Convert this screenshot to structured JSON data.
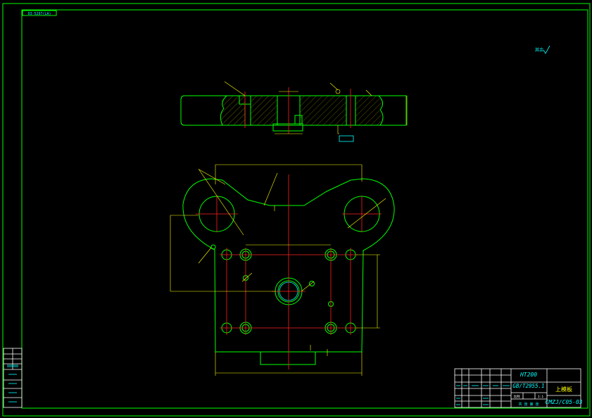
{
  "drawing": {
    "corner_code": "03-5297(LA)",
    "roughness_note": "其余",
    "title_block": {
      "material": "HT200",
      "standard": "GB/T2955.1",
      "part_name": "上模板",
      "drawing_number": "CMZJ/C05-03",
      "scale_label": "比例",
      "scale_value": "1:1",
      "sheet_label": "共 张 第 张"
    },
    "colors": {
      "border": "#00ff00",
      "outline": "#00ff00",
      "center_line": "#ff2020",
      "dimension": "#ffff00",
      "text": "#00ffff",
      "background": "#000000"
    }
  }
}
